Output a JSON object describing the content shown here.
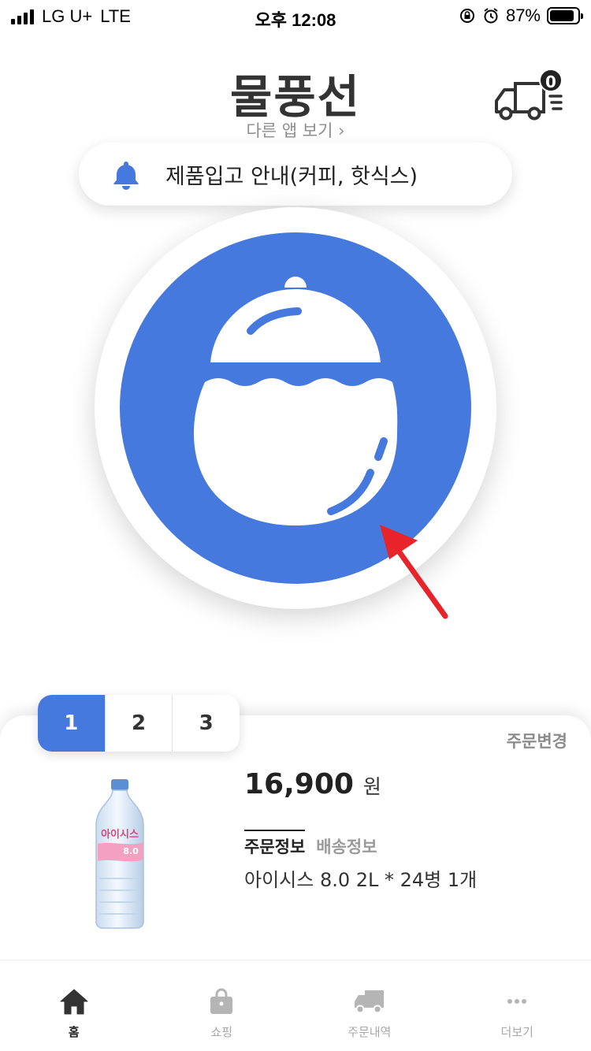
{
  "status_bar": {
    "carrier": "LG U+",
    "network": "LTE",
    "time": "오후 12:08",
    "battery": "87%",
    "battery_level": 0.87
  },
  "header": {
    "title": "물풍선",
    "other_apps": "다른 앱 보기",
    "delivery_count": "0"
  },
  "notice": {
    "text": "제품입고 안내(커피, 핫식스)",
    "icon": "bell-icon"
  },
  "main": {
    "button_icon": "water-balloon-icon",
    "accent_color": "#4579de",
    "arrow_color": "#e8242b"
  },
  "order_card": {
    "tabs": [
      {
        "label": "1",
        "active": true
      },
      {
        "label": "2",
        "active": false
      },
      {
        "label": "3",
        "active": false
      }
    ],
    "change_order": "주문변경",
    "price": "16,900",
    "currency": "원",
    "info_tabs": {
      "order_info": "주문정보",
      "delivery_info": "배송정보"
    },
    "order_desc": "아이시스 8.0 2L * 24병 1개",
    "product_label": "아이시스",
    "product_sub": "8.0"
  },
  "bottom_nav": {
    "items": [
      {
        "label": "홈",
        "icon": "home-icon",
        "active": true
      },
      {
        "label": "쇼핑",
        "icon": "shopping-bag-icon",
        "active": false
      },
      {
        "label": "주문내역",
        "icon": "truck-icon",
        "active": false
      },
      {
        "label": "더보기",
        "icon": "more-icon",
        "active": false
      }
    ]
  }
}
